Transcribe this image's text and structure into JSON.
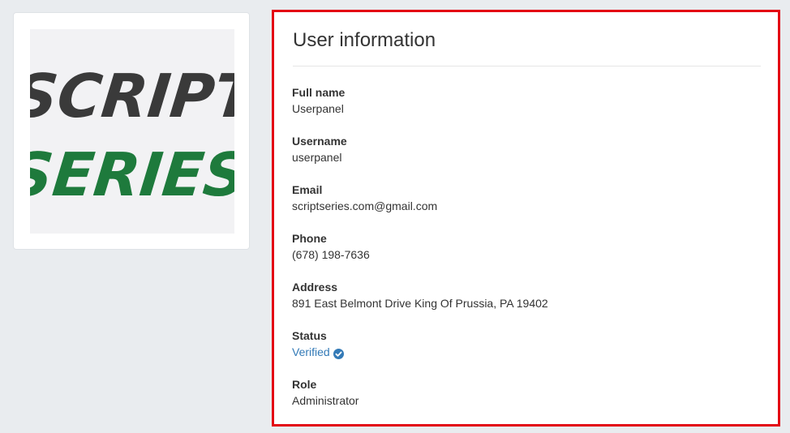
{
  "logo": {
    "line1": "SCRIPT",
    "line2": "SERIES",
    "line1_color": "#3a3a3a",
    "line2_color": "#1e7a3c"
  },
  "user_info": {
    "title": "User information",
    "fields": [
      {
        "label": "Full name",
        "value": "Userpanel"
      },
      {
        "label": "Username",
        "value": "userpanel"
      },
      {
        "label": "Email",
        "value": "scriptseries.com@gmail.com"
      },
      {
        "label": "Phone",
        "value": "(678) 198-7636"
      },
      {
        "label": "Address",
        "value": "891 East Belmont Drive King Of Prussia, PA 19402"
      },
      {
        "label": "Status",
        "value": "Verified",
        "icon": "check-circle-icon"
      },
      {
        "label": "Role",
        "value": "Administrator"
      }
    ]
  },
  "colors": {
    "status_verified": "#337ab7",
    "highlight_border": "#e30613"
  }
}
